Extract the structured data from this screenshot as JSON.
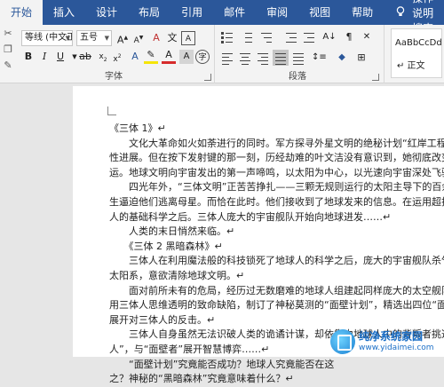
{
  "tabs": [
    "开始",
    "插入",
    "设计",
    "布局",
    "引用",
    "邮件",
    "审阅",
    "视图",
    "帮助"
  ],
  "search_label": "操作说明搜索",
  "font": {
    "name": "等线 (中文正文)",
    "size": "五号",
    "group_label": "字体"
  },
  "paragraph": {
    "group_label": "段落"
  },
  "styles": {
    "sample": "AaBbCcDd",
    "name": "↵ 正文"
  },
  "document": {
    "lines": [
      "《三体 1》↵",
      "　　文化大革命如火如荼进行的同时。军方探寻外星文明的绝秘计划“红岸工程”取得了突",
      "性进展。但在按下发射键的那一刻，历经劫难的叶文洁没有意识到，她彻底改变了人类的",
      "运。地球文明向宇宙发出的第一声啼鸣，以太阳为中心，以光速向宇宙深处飞驰……↵",
      "　　四光年外，“三体文明”正苦苦挣扎——三颗无规则运行的太阳主导下的百余次毁灭",
      "生逼迫他们逃离母星。而恰在此时。他们接收到了地球发来的信息。在运用超技术锁死地",
      "人的基础科学之后。三体人庞大的宇宙舰队开始向地球进发……↵",
      "　　人类的末日悄然来临。↵",
      "　　《三体 2 黑暗森林》↵",
      "　　三体人在利用魔法般的科技锁死了地球人的科学之后，庞大的宇宙舰队杀气腾腾地直",
      "太阳系，意欲清除地球文明。↵",
      "　　面对前所未有的危局，经历过无数磨难的地球人组建起同样庞大的太空舰队，同时",
      "用三体人思维透明的致命缺陷，制订了神秘莫测的“面壁计划”，精选出四位“面壁者”。秘",
      "展开对三体人的反击。↵",
      "　　三体人自身虽然无法识破人类的诡谲计谋，却依靠由地球人中的背叛者挑选出的“破",
      "人”，与“面壁者”展开智慧博弈……↵",
      "　　“面壁计划”究竟能否成功？地球人究竟能否在这",
      "之？神秘的“黑暗森林”究竟意味着什么？↵"
    ]
  },
  "watermark": {
    "title": "纯净系统家园",
    "url": "www.yidaimei.com"
  },
  "icons": {
    "search": "lightbulb-icon",
    "bold": "bold-icon",
    "italic": "italic-icon",
    "underline": "underline-icon"
  }
}
